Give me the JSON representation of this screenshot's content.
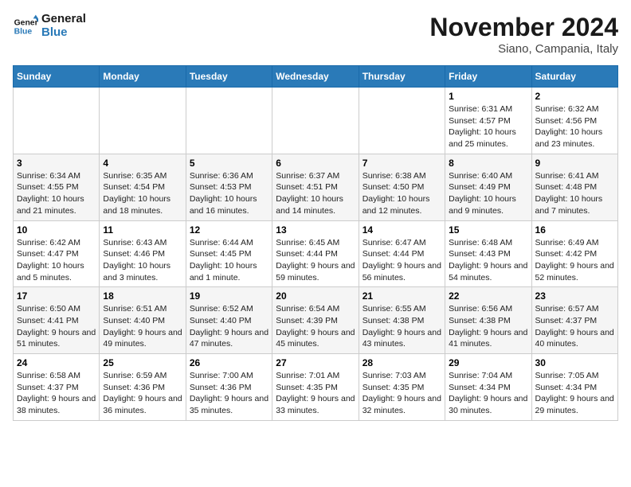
{
  "logo": {
    "line1": "General",
    "line2": "Blue"
  },
  "title": "November 2024",
  "location": "Siano, Campania, Italy",
  "days_of_week": [
    "Sunday",
    "Monday",
    "Tuesday",
    "Wednesday",
    "Thursday",
    "Friday",
    "Saturday"
  ],
  "weeks": [
    [
      {
        "day": "",
        "info": ""
      },
      {
        "day": "",
        "info": ""
      },
      {
        "day": "",
        "info": ""
      },
      {
        "day": "",
        "info": ""
      },
      {
        "day": "",
        "info": ""
      },
      {
        "day": "1",
        "info": "Sunrise: 6:31 AM\nSunset: 4:57 PM\nDaylight: 10 hours and 25 minutes."
      },
      {
        "day": "2",
        "info": "Sunrise: 6:32 AM\nSunset: 4:56 PM\nDaylight: 10 hours and 23 minutes."
      }
    ],
    [
      {
        "day": "3",
        "info": "Sunrise: 6:34 AM\nSunset: 4:55 PM\nDaylight: 10 hours and 21 minutes."
      },
      {
        "day": "4",
        "info": "Sunrise: 6:35 AM\nSunset: 4:54 PM\nDaylight: 10 hours and 18 minutes."
      },
      {
        "day": "5",
        "info": "Sunrise: 6:36 AM\nSunset: 4:53 PM\nDaylight: 10 hours and 16 minutes."
      },
      {
        "day": "6",
        "info": "Sunrise: 6:37 AM\nSunset: 4:51 PM\nDaylight: 10 hours and 14 minutes."
      },
      {
        "day": "7",
        "info": "Sunrise: 6:38 AM\nSunset: 4:50 PM\nDaylight: 10 hours and 12 minutes."
      },
      {
        "day": "8",
        "info": "Sunrise: 6:40 AM\nSunset: 4:49 PM\nDaylight: 10 hours and 9 minutes."
      },
      {
        "day": "9",
        "info": "Sunrise: 6:41 AM\nSunset: 4:48 PM\nDaylight: 10 hours and 7 minutes."
      }
    ],
    [
      {
        "day": "10",
        "info": "Sunrise: 6:42 AM\nSunset: 4:47 PM\nDaylight: 10 hours and 5 minutes."
      },
      {
        "day": "11",
        "info": "Sunrise: 6:43 AM\nSunset: 4:46 PM\nDaylight: 10 hours and 3 minutes."
      },
      {
        "day": "12",
        "info": "Sunrise: 6:44 AM\nSunset: 4:45 PM\nDaylight: 10 hours and 1 minute."
      },
      {
        "day": "13",
        "info": "Sunrise: 6:45 AM\nSunset: 4:44 PM\nDaylight: 9 hours and 59 minutes."
      },
      {
        "day": "14",
        "info": "Sunrise: 6:47 AM\nSunset: 4:44 PM\nDaylight: 9 hours and 56 minutes."
      },
      {
        "day": "15",
        "info": "Sunrise: 6:48 AM\nSunset: 4:43 PM\nDaylight: 9 hours and 54 minutes."
      },
      {
        "day": "16",
        "info": "Sunrise: 6:49 AM\nSunset: 4:42 PM\nDaylight: 9 hours and 52 minutes."
      }
    ],
    [
      {
        "day": "17",
        "info": "Sunrise: 6:50 AM\nSunset: 4:41 PM\nDaylight: 9 hours and 51 minutes."
      },
      {
        "day": "18",
        "info": "Sunrise: 6:51 AM\nSunset: 4:40 PM\nDaylight: 9 hours and 49 minutes."
      },
      {
        "day": "19",
        "info": "Sunrise: 6:52 AM\nSunset: 4:40 PM\nDaylight: 9 hours and 47 minutes."
      },
      {
        "day": "20",
        "info": "Sunrise: 6:54 AM\nSunset: 4:39 PM\nDaylight: 9 hours and 45 minutes."
      },
      {
        "day": "21",
        "info": "Sunrise: 6:55 AM\nSunset: 4:38 PM\nDaylight: 9 hours and 43 minutes."
      },
      {
        "day": "22",
        "info": "Sunrise: 6:56 AM\nSunset: 4:38 PM\nDaylight: 9 hours and 41 minutes."
      },
      {
        "day": "23",
        "info": "Sunrise: 6:57 AM\nSunset: 4:37 PM\nDaylight: 9 hours and 40 minutes."
      }
    ],
    [
      {
        "day": "24",
        "info": "Sunrise: 6:58 AM\nSunset: 4:37 PM\nDaylight: 9 hours and 38 minutes."
      },
      {
        "day": "25",
        "info": "Sunrise: 6:59 AM\nSunset: 4:36 PM\nDaylight: 9 hours and 36 minutes."
      },
      {
        "day": "26",
        "info": "Sunrise: 7:00 AM\nSunset: 4:36 PM\nDaylight: 9 hours and 35 minutes."
      },
      {
        "day": "27",
        "info": "Sunrise: 7:01 AM\nSunset: 4:35 PM\nDaylight: 9 hours and 33 minutes."
      },
      {
        "day": "28",
        "info": "Sunrise: 7:03 AM\nSunset: 4:35 PM\nDaylight: 9 hours and 32 minutes."
      },
      {
        "day": "29",
        "info": "Sunrise: 7:04 AM\nSunset: 4:34 PM\nDaylight: 9 hours and 30 minutes."
      },
      {
        "day": "30",
        "info": "Sunrise: 7:05 AM\nSunset: 4:34 PM\nDaylight: 9 hours and 29 minutes."
      }
    ]
  ]
}
